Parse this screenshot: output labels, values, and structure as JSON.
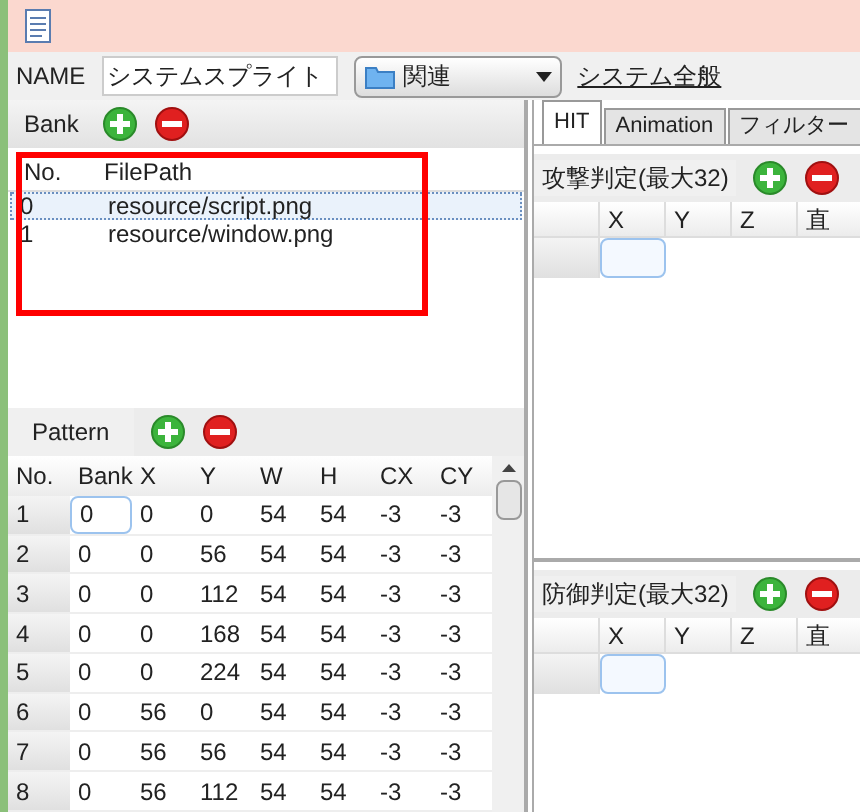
{
  "toolbar": {
    "name_label": "NAME",
    "name_value": "システムスプライト",
    "category": "関連",
    "link": "システム全般"
  },
  "bank": {
    "title": "Bank",
    "highlighted": true,
    "columns": [
      "No.",
      "FilePath"
    ],
    "rows": [
      {
        "cells": [
          "0",
          "resource/script.png"
        ],
        "selected": true
      },
      {
        "cells": [
          "1",
          "resource/window.png"
        ],
        "selected": false
      }
    ]
  },
  "pattern": {
    "title": "Pattern",
    "columns": [
      "No.",
      "Bank",
      "X",
      "Y",
      "W",
      "H",
      "CX",
      "CY"
    ],
    "rows": [
      [
        "1",
        "0",
        "0",
        "0",
        "54",
        "54",
        "-3",
        "-3"
      ],
      [
        "2",
        "0",
        "0",
        "56",
        "54",
        "54",
        "-3",
        "-3"
      ],
      [
        "3",
        "0",
        "0",
        "112",
        "54",
        "54",
        "-3",
        "-3"
      ],
      [
        "4",
        "0",
        "0",
        "168",
        "54",
        "54",
        "-3",
        "-3"
      ],
      [
        "5",
        "0",
        "0",
        "224",
        "54",
        "54",
        "-3",
        "-3"
      ],
      [
        "6",
        "0",
        "56",
        "0",
        "54",
        "54",
        "-3",
        "-3"
      ],
      [
        "7",
        "0",
        "56",
        "56",
        "54",
        "54",
        "-3",
        "-3"
      ],
      [
        "8",
        "0",
        "56",
        "112",
        "54",
        "54",
        "-3",
        "-3"
      ]
    ]
  },
  "tabs": [
    {
      "label": "HIT",
      "selected": true
    },
    {
      "label": "Animation",
      "selected": false
    },
    {
      "label": "フィルター",
      "selected": false
    }
  ],
  "hit_sections": [
    {
      "title": "攻撃判定(最大32)",
      "columns": [
        "X",
        "Y",
        "Z",
        "直"
      ]
    },
    {
      "title": "防御判定(最大32)",
      "columns": [
        "X",
        "Y",
        "Z",
        "直"
      ]
    }
  ]
}
